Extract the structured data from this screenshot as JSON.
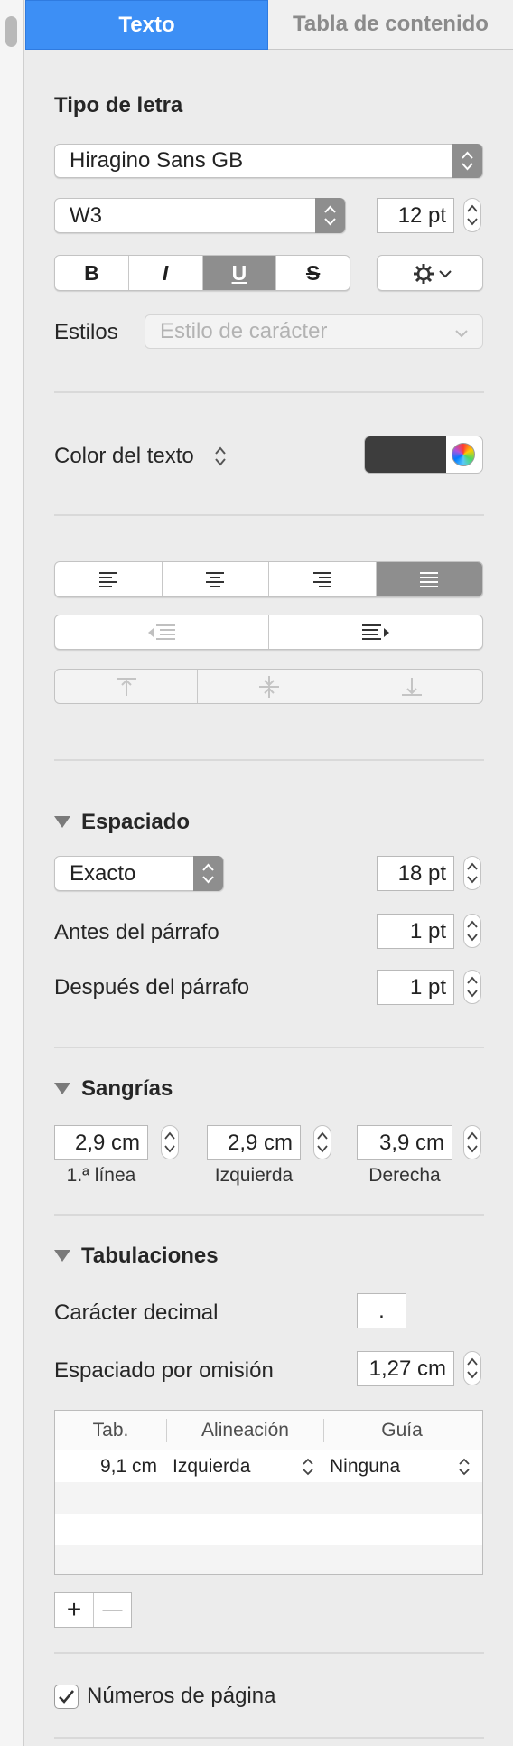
{
  "tabs": {
    "active": "Texto",
    "inactive": "Tabla de contenido"
  },
  "font": {
    "heading": "Tipo de letra",
    "family": "Hiragino Sans GB",
    "weight": "W3",
    "size": "12 pt",
    "style_buttons": [
      "B",
      "I",
      "U",
      "S"
    ],
    "active_style": "U",
    "styles_label": "Estilos",
    "char_style_placeholder": "Estilo de carácter"
  },
  "text_color": {
    "label": "Color del texto",
    "swatch_color": "#3d3d3d"
  },
  "alignment": {
    "active": "justify"
  },
  "spacing": {
    "heading": "Espaciado",
    "mode": "Exacto",
    "value": "18 pt",
    "before_label": "Antes del párrafo",
    "before_value": "1 pt",
    "after_label": "Después del párrafo",
    "after_value": "1 pt"
  },
  "indents": {
    "heading": "Sangrías",
    "first_value": "2,9 cm",
    "first_label": "1.ª línea",
    "left_value": "2,9 cm",
    "left_label": "Izquierda",
    "right_value": "3,9 cm",
    "right_label": "Derecha"
  },
  "tabs_section": {
    "heading": "Tabulaciones",
    "decimal_label": "Carácter decimal",
    "decimal_value": ".",
    "default_label": "Espaciado por omisión",
    "default_value": "1,27 cm",
    "columns": [
      "Tab.",
      "Alineación",
      "Guía"
    ],
    "rows": [
      {
        "tab": "9,1 cm",
        "align": "Izquierda",
        "leader": "Ninguna"
      }
    ],
    "add": "+",
    "remove": "—"
  },
  "page_numbers": {
    "label": "Números de página",
    "checked": true
  },
  "colors": {
    "accent": "#3d8ff5",
    "segment_selected": "#8e8e8e"
  }
}
